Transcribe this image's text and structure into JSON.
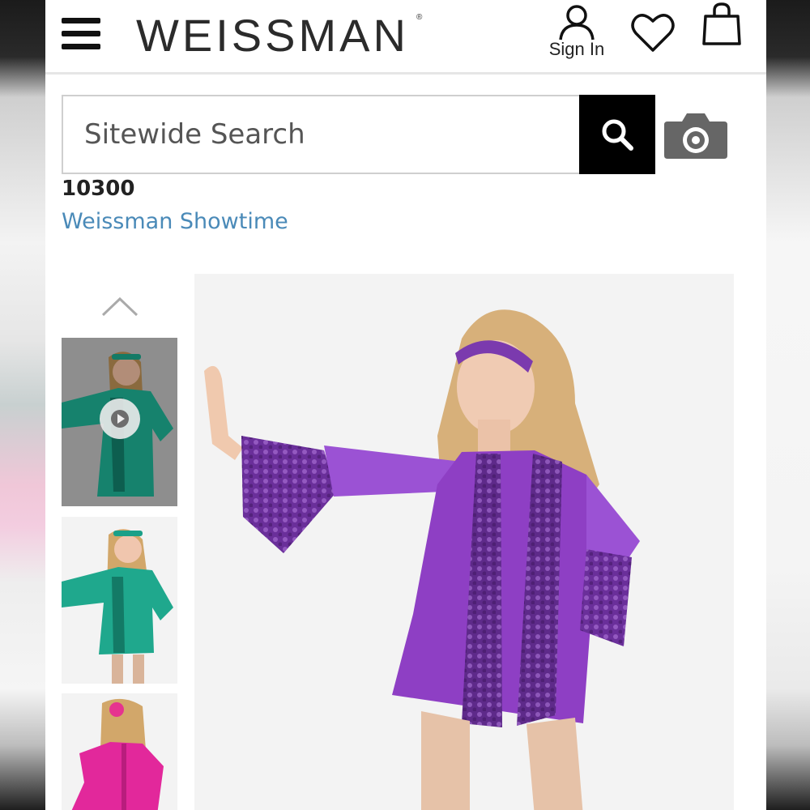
{
  "header": {
    "brand": "WEISSMAN",
    "registered_mark": "®",
    "sign_in_label": "Sign In",
    "icons": [
      "menu-icon",
      "user-icon",
      "heart-icon",
      "shopping-bag-icon"
    ]
  },
  "search": {
    "placeholder": "Sitewide Search",
    "icons": [
      "search-icon",
      "camera-icon"
    ]
  },
  "product": {
    "sku": "10300",
    "collection_link": "Weissman Showtime",
    "main_color": "#8e3fc4"
  },
  "gallery": {
    "thumbnails": [
      {
        "color": "#1e9e86",
        "has_video": true
      },
      {
        "color": "#1e9e86",
        "has_video": false
      },
      {
        "color": "#e0299a",
        "has_video": false
      }
    ],
    "icons": [
      "chevron-up-icon",
      "play-icon"
    ]
  },
  "colors": {
    "link": "#4a8ab8",
    "search_button": "#000000",
    "camera": "#666666"
  }
}
